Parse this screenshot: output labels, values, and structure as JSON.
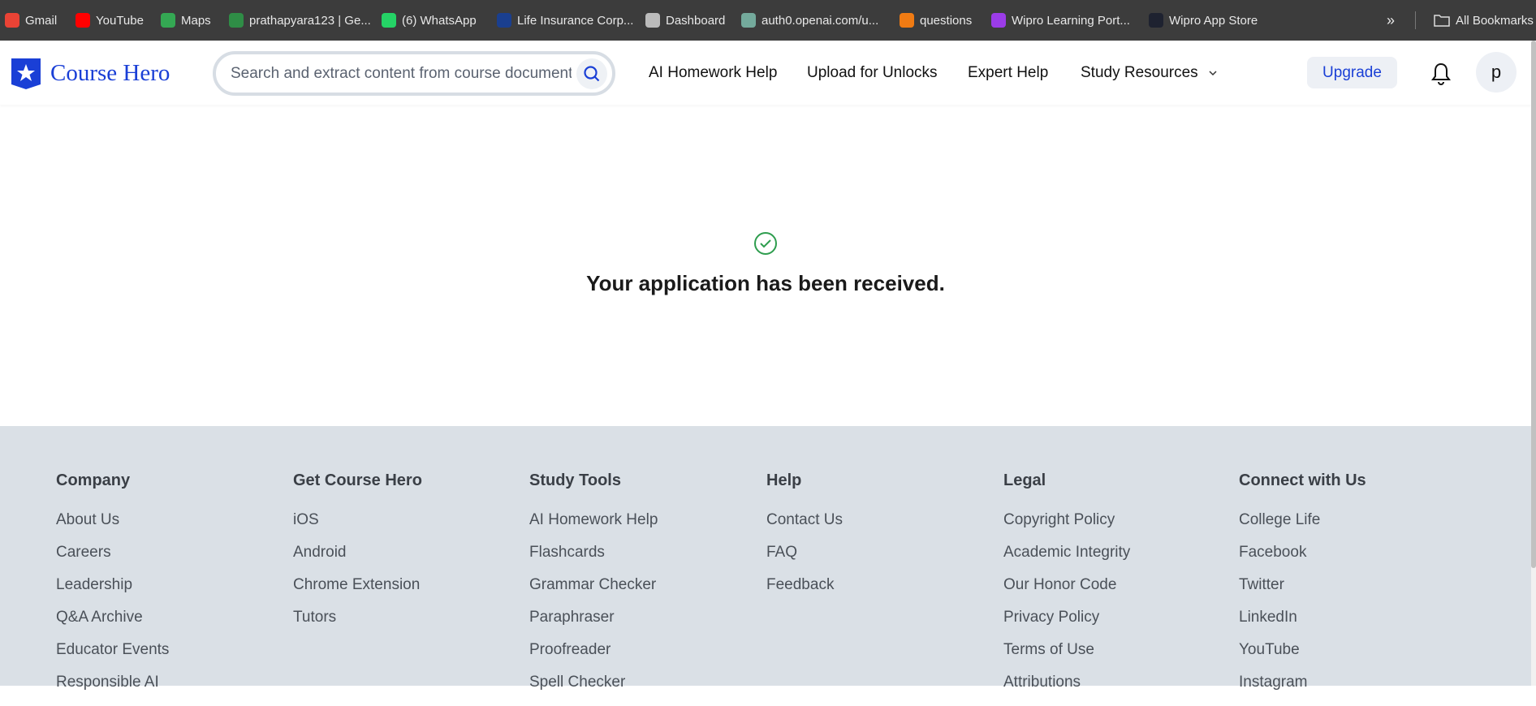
{
  "bookmarks": [
    {
      "label": "Gmail",
      "icon": "gmail-icon",
      "color": "#ea4335"
    },
    {
      "label": "YouTube",
      "icon": "youtube-icon",
      "color": "#ff0000"
    },
    {
      "label": "Maps",
      "icon": "maps-icon",
      "color": "#34a853"
    },
    {
      "label": "prathapyara123 | Ge...",
      "icon": "geeksforgeeks-icon",
      "color": "#2f8d46"
    },
    {
      "label": "(6) WhatsApp",
      "icon": "whatsapp-icon",
      "color": "#25d366"
    },
    {
      "label": "Life Insurance Corp...",
      "icon": "lic-icon",
      "color": "#1a3f8f"
    },
    {
      "label": "Dashboard",
      "icon": "globe-icon",
      "color": "#bbbbbb"
    },
    {
      "label": "auth0.openai.com/u...",
      "icon": "openai-icon",
      "color": "#74aa9c"
    },
    {
      "label": "questions",
      "icon": "c-icon",
      "color": "#f07b13"
    },
    {
      "label": "Wipro Learning Port...",
      "icon": "wipro-learning-icon",
      "color": "#9b3ce8"
    },
    {
      "label": "Wipro App Store",
      "icon": "wipro-appstore-icon",
      "color": "#1e2230"
    }
  ],
  "bookmarks_more": "»",
  "all_bookmarks": "All Bookmarks",
  "header": {
    "logo": "Course Hero",
    "search_placeholder": "Search and extract content from course documents, study guides, and more",
    "nav": [
      "AI Homework Help",
      "Upload for Unlocks",
      "Expert Help",
      "Study Resources"
    ],
    "upgrade": "Upgrade",
    "avatar": "p"
  },
  "main": {
    "message": "Your application has been received."
  },
  "footer": {
    "columns": [
      {
        "title": "Company",
        "links": [
          "About Us",
          "Careers",
          "Leadership",
          "Q&A Archive",
          "Educator Events",
          "Responsible AI"
        ]
      },
      {
        "title": "Get Course Hero",
        "links": [
          "iOS",
          "Android",
          "Chrome Extension",
          "Tutors"
        ]
      },
      {
        "title": "Study Tools",
        "links": [
          "AI Homework Help",
          "Flashcards",
          "Grammar Checker",
          "Paraphraser",
          "Proofreader",
          "Spell Checker"
        ]
      },
      {
        "title": "Help",
        "links": [
          "Contact Us",
          "FAQ",
          "Feedback"
        ]
      },
      {
        "title": "Legal",
        "links": [
          "Copyright Policy",
          "Academic Integrity",
          "Our Honor Code",
          "Privacy Policy",
          "Terms of Use",
          "Attributions"
        ]
      },
      {
        "title": "Connect with Us",
        "links": [
          "College Life",
          "Facebook",
          "Twitter",
          "LinkedIn",
          "YouTube",
          "Instagram"
        ]
      }
    ]
  }
}
